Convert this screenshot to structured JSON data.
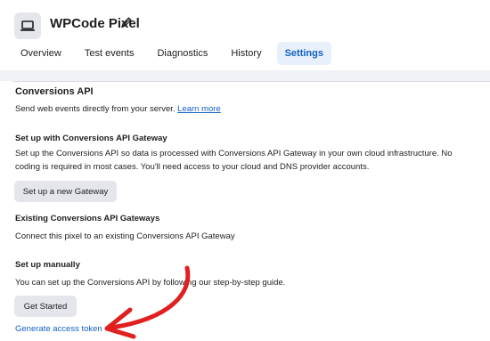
{
  "header": {
    "title": "WPCode Pixel",
    "pixel_icon": "laptop-icon",
    "edit_icon": "pencil-icon"
  },
  "tabs": [
    {
      "label": "Overview",
      "active": false
    },
    {
      "label": "Test events",
      "active": false
    },
    {
      "label": "Diagnostics",
      "active": false
    },
    {
      "label": "History",
      "active": false
    },
    {
      "label": "Settings",
      "active": true
    }
  ],
  "conversions": {
    "heading": "Conversions API",
    "description": "Send web events directly from your server.",
    "learn_more": "Learn more"
  },
  "gateway": {
    "heading": "Set up with Conversions API Gateway",
    "line1": "Set up the Conversions API so data is processed with Conversions API Gateway in your own cloud infrastructure. No",
    "line2": "coding is required in most cases. You'll need access to your cloud and DNS provider accounts.",
    "button": "Set up a new Gateway"
  },
  "existing": {
    "heading": "Existing Conversions API Gateways",
    "description": "Connect this pixel to an existing Conversions API Gateway"
  },
  "manual": {
    "heading": "Set up manually",
    "description": "You can set up the Conversions API by following our step-by-step guide.",
    "button": "Get Started",
    "token_link": "Generate access token"
  },
  "annotation": {
    "arrow_color": "#e0201f"
  },
  "colors": {
    "accent": "#1261c4",
    "tab_active_bg": "#e7f0fb",
    "button_bg": "#e4e6eb",
    "page_gray": "#f0f2f5"
  }
}
